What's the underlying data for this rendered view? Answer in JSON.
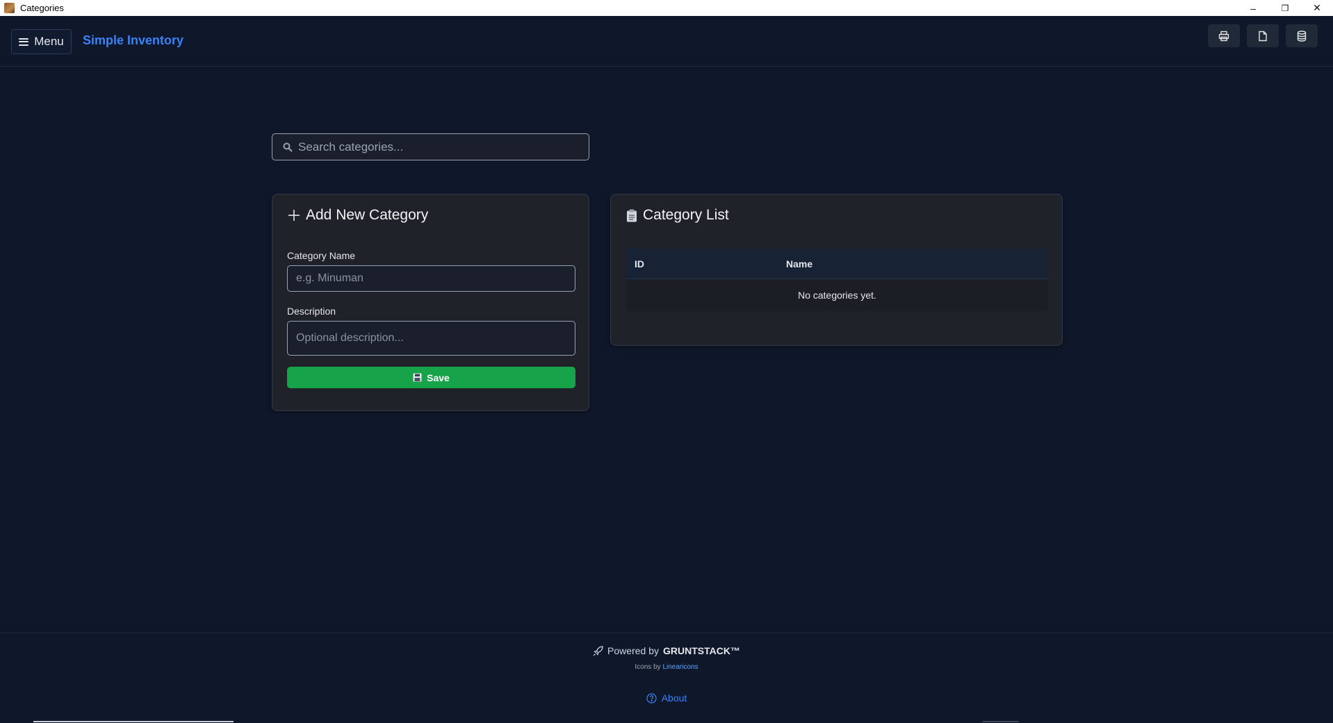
{
  "window": {
    "title": "Categories",
    "controls": {
      "minimize": "–",
      "maximize": "❐",
      "close": "✕"
    }
  },
  "header": {
    "menu_label": "Menu",
    "brand": "Simple Inventory",
    "icons": [
      "printer-icon",
      "document-icon",
      "database-icon"
    ]
  },
  "search": {
    "placeholder": "Search categories..."
  },
  "add_card": {
    "title": "Add New Category",
    "name_label": "Category Name",
    "name_placeholder": "e.g. Minuman",
    "name_value": "",
    "desc_label": "Description",
    "desc_placeholder": "Optional description...",
    "desc_value": "",
    "save_label": "Save"
  },
  "list_card": {
    "title": "Category List",
    "columns": [
      "ID",
      "Name"
    ],
    "empty_text": "No categories yet."
  },
  "footer": {
    "powered_prefix": "Powered by",
    "powered_brand": "GRUNTSTACK™",
    "icons_prefix": "Icons by",
    "icons_link": "Linearicons",
    "about_label": "About"
  },
  "colors": {
    "background": "#0f172a",
    "brand": "#3b82f6",
    "save": "#16a34a",
    "card": "#1f2329"
  }
}
